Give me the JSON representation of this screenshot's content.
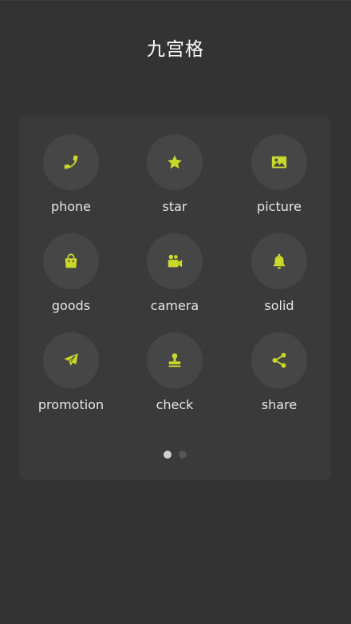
{
  "header": {
    "title": "九宫格"
  },
  "colors": {
    "background": "#333333",
    "card": "#3b3a3a",
    "icon_circle": "#474646",
    "icon_accent": "#c9d82b",
    "label_text": "#e6e6e6",
    "dot_active": "#cfcfcf",
    "dot_inactive": "#555555"
  },
  "grid": {
    "items": [
      {
        "label": "phone",
        "icon": "phone-icon"
      },
      {
        "label": "star",
        "icon": "star-icon"
      },
      {
        "label": "picture",
        "icon": "picture-icon"
      },
      {
        "label": "goods",
        "icon": "shopping-bag-icon"
      },
      {
        "label": "camera",
        "icon": "video-camera-icon"
      },
      {
        "label": "solid",
        "icon": "bell-icon"
      },
      {
        "label": "promotion",
        "icon": "paper-plane-icon"
      },
      {
        "label": "check",
        "icon": "stamp-icon"
      },
      {
        "label": "share",
        "icon": "share-icon"
      }
    ]
  },
  "pagination": {
    "pages": 2,
    "current": 1
  }
}
